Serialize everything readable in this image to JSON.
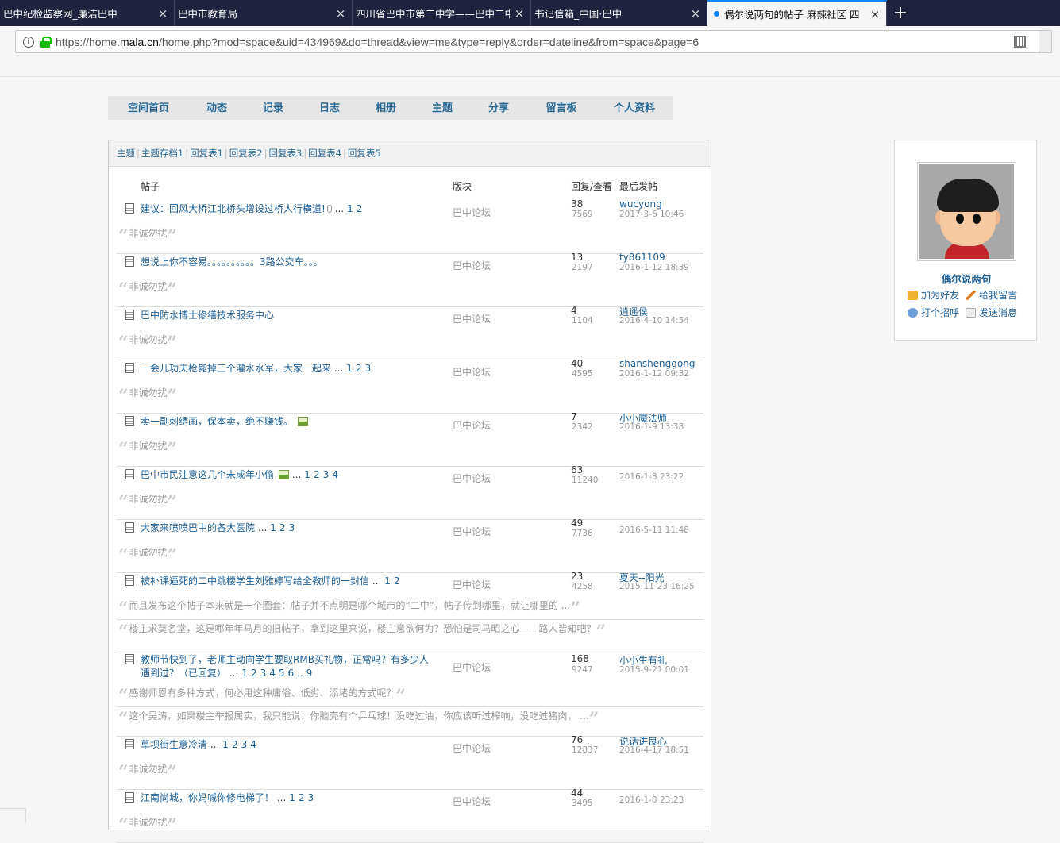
{
  "tabs": [
    {
      "title": "巴中纪检监察网_廉洁巴中"
    },
    {
      "title": "巴中市教育局"
    },
    {
      "title": "四川省巴中市第二中学——巴中二中"
    },
    {
      "title": "书记信箱_中国·巴中"
    },
    {
      "title": "偶尔说两句的帖子 麻辣社区 四"
    }
  ],
  "new_tab_label": "+",
  "tab_close": "×",
  "url": {
    "prefix": "https://home.",
    "domain": "mala.cn",
    "path": "/home.php?mod=space&uid=434969&do=thread&view=me&type=reply&order=dateline&from=space&page=6"
  },
  "nav": [
    "空间首页",
    "动态",
    "记录",
    "日志",
    "相册",
    "主题",
    "分享",
    "留言板",
    "个人资料"
  ],
  "subnav": [
    "主题",
    "主题存档1",
    "回复表1",
    "回复表2",
    "回复表3",
    "回复表4",
    "回复表5"
  ],
  "table_header": {
    "post": "帖子",
    "forum": "版块",
    "reply_view": "回复/查看",
    "last": "最后发帖"
  },
  "threads": [
    {
      "title": "建议：回风大桥江北桥头增设过桥人行横道!",
      "attach": true,
      "dots": "...",
      "pages": [
        "1",
        "2"
      ],
      "forum": "巴中论坛",
      "replies": "38",
      "views": "7569",
      "last_user": "wucyong",
      "last_date": "2017-3-6 10:46",
      "quotes": [
        "非诚勿扰"
      ]
    },
    {
      "title": "想说上你不容易。。。。。。。。。。3路公交车。。。",
      "pages": [],
      "forum": "巴中论坛",
      "replies": "13",
      "views": "2197",
      "last_user": "ty861109",
      "last_date": "2016-1-12 18:39",
      "quotes": [
        "非诚勿扰"
      ]
    },
    {
      "title": "巴中防水博士修缮技术服务中心",
      "pages": [],
      "forum": "巴中论坛",
      "replies": "4",
      "views": "1104",
      "last_user": "逍遥侯",
      "last_date": "2016-4-10 14:54",
      "quotes": [
        "非诚勿扰"
      ]
    },
    {
      "title": "一会儿功夫枪毙掉三个灌水水军，大家一起来",
      "dots": "...",
      "pages": [
        "1",
        "2",
        "3"
      ],
      "forum": "巴中论坛",
      "replies": "40",
      "views": "4595",
      "last_user": "shanshenggong",
      "last_date": "2016-1-12 09:32",
      "quotes": [
        "非诚勿扰"
      ]
    },
    {
      "title": "卖一副刺绣画，保本卖，绝不赚钱。",
      "image": true,
      "pages": [],
      "forum": "巴中论坛",
      "replies": "7",
      "views": "2342",
      "last_user": "小小魔法师",
      "last_date": "2016-1-9 13:38",
      "quotes": [
        "非诚勿扰"
      ]
    },
    {
      "title": "巴中市民注意这几个未成年小偷",
      "image": true,
      "dots": "...",
      "pages": [
        "1",
        "2",
        "3",
        "4"
      ],
      "forum": "巴中论坛",
      "replies": "63",
      "views": "11240",
      "last_user": "",
      "last_date": "2016-1-8 23:22",
      "quotes": [
        "非诚勿扰"
      ]
    },
    {
      "title": "大家来喷喷巴中的各大医院",
      "dots": "...",
      "pages": [
        "1",
        "2",
        "3"
      ],
      "forum": "巴中论坛",
      "replies": "49",
      "views": "7736",
      "last_user": "",
      "last_date": "2016-5-11 11:48",
      "quotes": [
        "非诚勿扰"
      ]
    },
    {
      "title": "被补课逼死的二中跳楼学生刘雅婷写给全教师的一封信",
      "dots": "...",
      "pages": [
        "1",
        "2"
      ],
      "forum": "巴中论坛",
      "replies": "23",
      "views": "4258",
      "last_user": "夏天--阳光",
      "last_date": "2015-11-23 16:25",
      "quotes": [
        "而且发布这个帖子本来就是一个圈套：帖子并不点明是哪个城市的“二中”，帖子传到哪里，就让哪里的 ...",
        "楼主求莫名堂，这是哪年年马月的旧帖子，拿到这里来说，楼主意欲何为？恐怕是司马昭之心——路人皆知吧？"
      ]
    },
    {
      "title": "教师节快到了，老师主动向学生要取RMB买礼物，正常吗？有多少人",
      "title2": "遇到过？（已回复）",
      "dots": "...",
      "pages": [
        "1",
        "2",
        "3",
        "4",
        "5",
        "6",
        ".. 9"
      ],
      "forum": "巴中论坛",
      "replies": "168",
      "views": "9247",
      "last_user": "小小生有礼",
      "last_date": "2015-9-21 00:01",
      "quotes": [
        "感谢师恩有多种方式，何必用这种庸俗、低劣、添堵的方式呢？",
        "这个吴涛，如果楼主举报属实，我只能说：你脑壳有个乒乓球！没吃过油，你应该听过榨响，没吃过猪肉， ..."
      ]
    },
    {
      "title": "草坝街生意冷清",
      "dots": "...",
      "pages": [
        "1",
        "2",
        "3",
        "4"
      ],
      "forum": "巴中论坛",
      "replies": "76",
      "views": "12837",
      "last_user": "说话讲良心",
      "last_date": "2016-4-17 18:51",
      "quotes": [
        "非诚勿扰"
      ]
    },
    {
      "title": "江南尚城，你妈喊你修电梯了！",
      "dots": "...",
      "pages": [
        "1",
        "2",
        "3"
      ],
      "forum": "巴中论坛",
      "replies": "44",
      "views": "3495",
      "last_user": "",
      "last_date": "2016-1-8 23:23",
      "quotes": [
        "非诚勿扰"
      ]
    }
  ],
  "profile": {
    "name": "偶尔说两句",
    "actions": [
      "加为好友",
      "给我留言",
      "打个招呼",
      "发送消息"
    ]
  },
  "colors": {
    "link": "#1d5f93",
    "tabbar": "#202340",
    "accent": "#0a84ff"
  }
}
